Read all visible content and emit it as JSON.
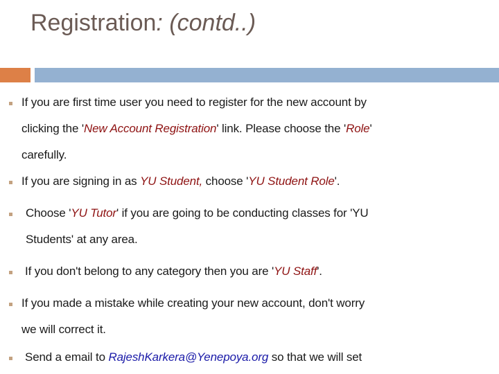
{
  "slide": {
    "title": {
      "main": "Registration",
      "sub": ": (contd..)"
    },
    "accent_orange": "#dd8047",
    "accent_blue": "#94b1d1",
    "title_color": "#6b5b55",
    "bullet_color": "#c3a281",
    "emphasis_red": "#8e1212",
    "emphasis_blue": "#1a1aa8"
  },
  "bullets": [
    {
      "id": "bullet-1",
      "line1_a": "If you are first time user you need to register for the new account by",
      "line2_a": "clicking the '",
      "line2_em": "New Account Registration",
      "line2_b": "' link. Please choose the '",
      "line2_em2": "Role",
      "line2_c": "'",
      "line3_a": "carefully."
    },
    {
      "id": "bullet-2",
      "line1_a": "If you are signing in as ",
      "line1_em": "YU Student,",
      "line1_b": " choose '",
      "line1_em2": "YU Student Role",
      "line1_c": "'."
    },
    {
      "id": "bullet-3",
      "line1_a": "Choose '",
      "line1_em": "YU Tutor",
      "line1_b": "' if you are going to be conducting classes for 'YU",
      "line2_a": "Students' at any area."
    },
    {
      "id": "bullet-4",
      "line1_a": "If you don't belong to any category then you are '",
      "line1_em": "YU Staff",
      "line1_b": "'."
    },
    {
      "id": "bullet-5",
      "line1_a": "If you made a mistake while creating your new account, don't worry",
      "line2_a": "we will correct it."
    },
    {
      "id": "bullet-6",
      "line1_a": "Send a email to ",
      "line1_em": "RajeshKarkera@Yenepoya.org",
      "line1_b": " so that we will set"
    }
  ]
}
